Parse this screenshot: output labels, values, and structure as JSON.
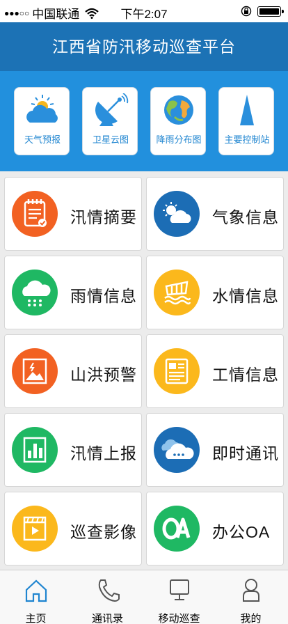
{
  "status_bar": {
    "carrier": "中国联通",
    "signal_dots": "●●●○○",
    "time": "下午2:07"
  },
  "header": {
    "title": "江西省防汛移动巡查平台"
  },
  "quick_tools": [
    {
      "label": "天气预报",
      "icon": "weather-cloud-icon"
    },
    {
      "label": "卫星云图",
      "icon": "satellite-dish-icon"
    },
    {
      "label": "降雨分布图",
      "icon": "globe-icon"
    },
    {
      "label": "主要控制站",
      "icon": "triangle-marker-icon"
    }
  ],
  "tiles": [
    {
      "label": "汛情摘要",
      "icon": "notepad-icon",
      "color": "#f26122"
    },
    {
      "label": "气象信息",
      "icon": "sun-cloud-icon",
      "color": "#1c6db5"
    },
    {
      "label": "雨情信息",
      "icon": "rain-cloud-icon",
      "color": "#1fb863"
    },
    {
      "label": "水情信息",
      "icon": "water-level-icon",
      "color": "#fbb81c"
    },
    {
      "label": "山洪预警",
      "icon": "landscape-picture-icon",
      "color": "#f26122"
    },
    {
      "label": "工情信息",
      "icon": "document-icon",
      "color": "#fbb81c"
    },
    {
      "label": "汛情上报",
      "icon": "bar-chart-icon",
      "color": "#1fb863"
    },
    {
      "label": "即时通讯",
      "icon": "chat-cloud-icon",
      "color": "#1c6db5"
    },
    {
      "label": "巡查影像",
      "icon": "video-clip-icon",
      "color": "#fbb81c"
    },
    {
      "label": "办公OA",
      "icon": "oa-logo-icon",
      "color": "#1fb863"
    }
  ],
  "tabbar": [
    {
      "label": "主页",
      "icon": "home-icon",
      "active": true
    },
    {
      "label": "通讯录",
      "icon": "phone-icon",
      "active": false
    },
    {
      "label": "移动巡查",
      "icon": "monitor-icon",
      "active": false
    },
    {
      "label": "我的",
      "icon": "person-icon",
      "active": false
    }
  ],
  "colors": {
    "header": "#1c72b5",
    "band": "#2290dd",
    "accent": "#1f85d0"
  }
}
